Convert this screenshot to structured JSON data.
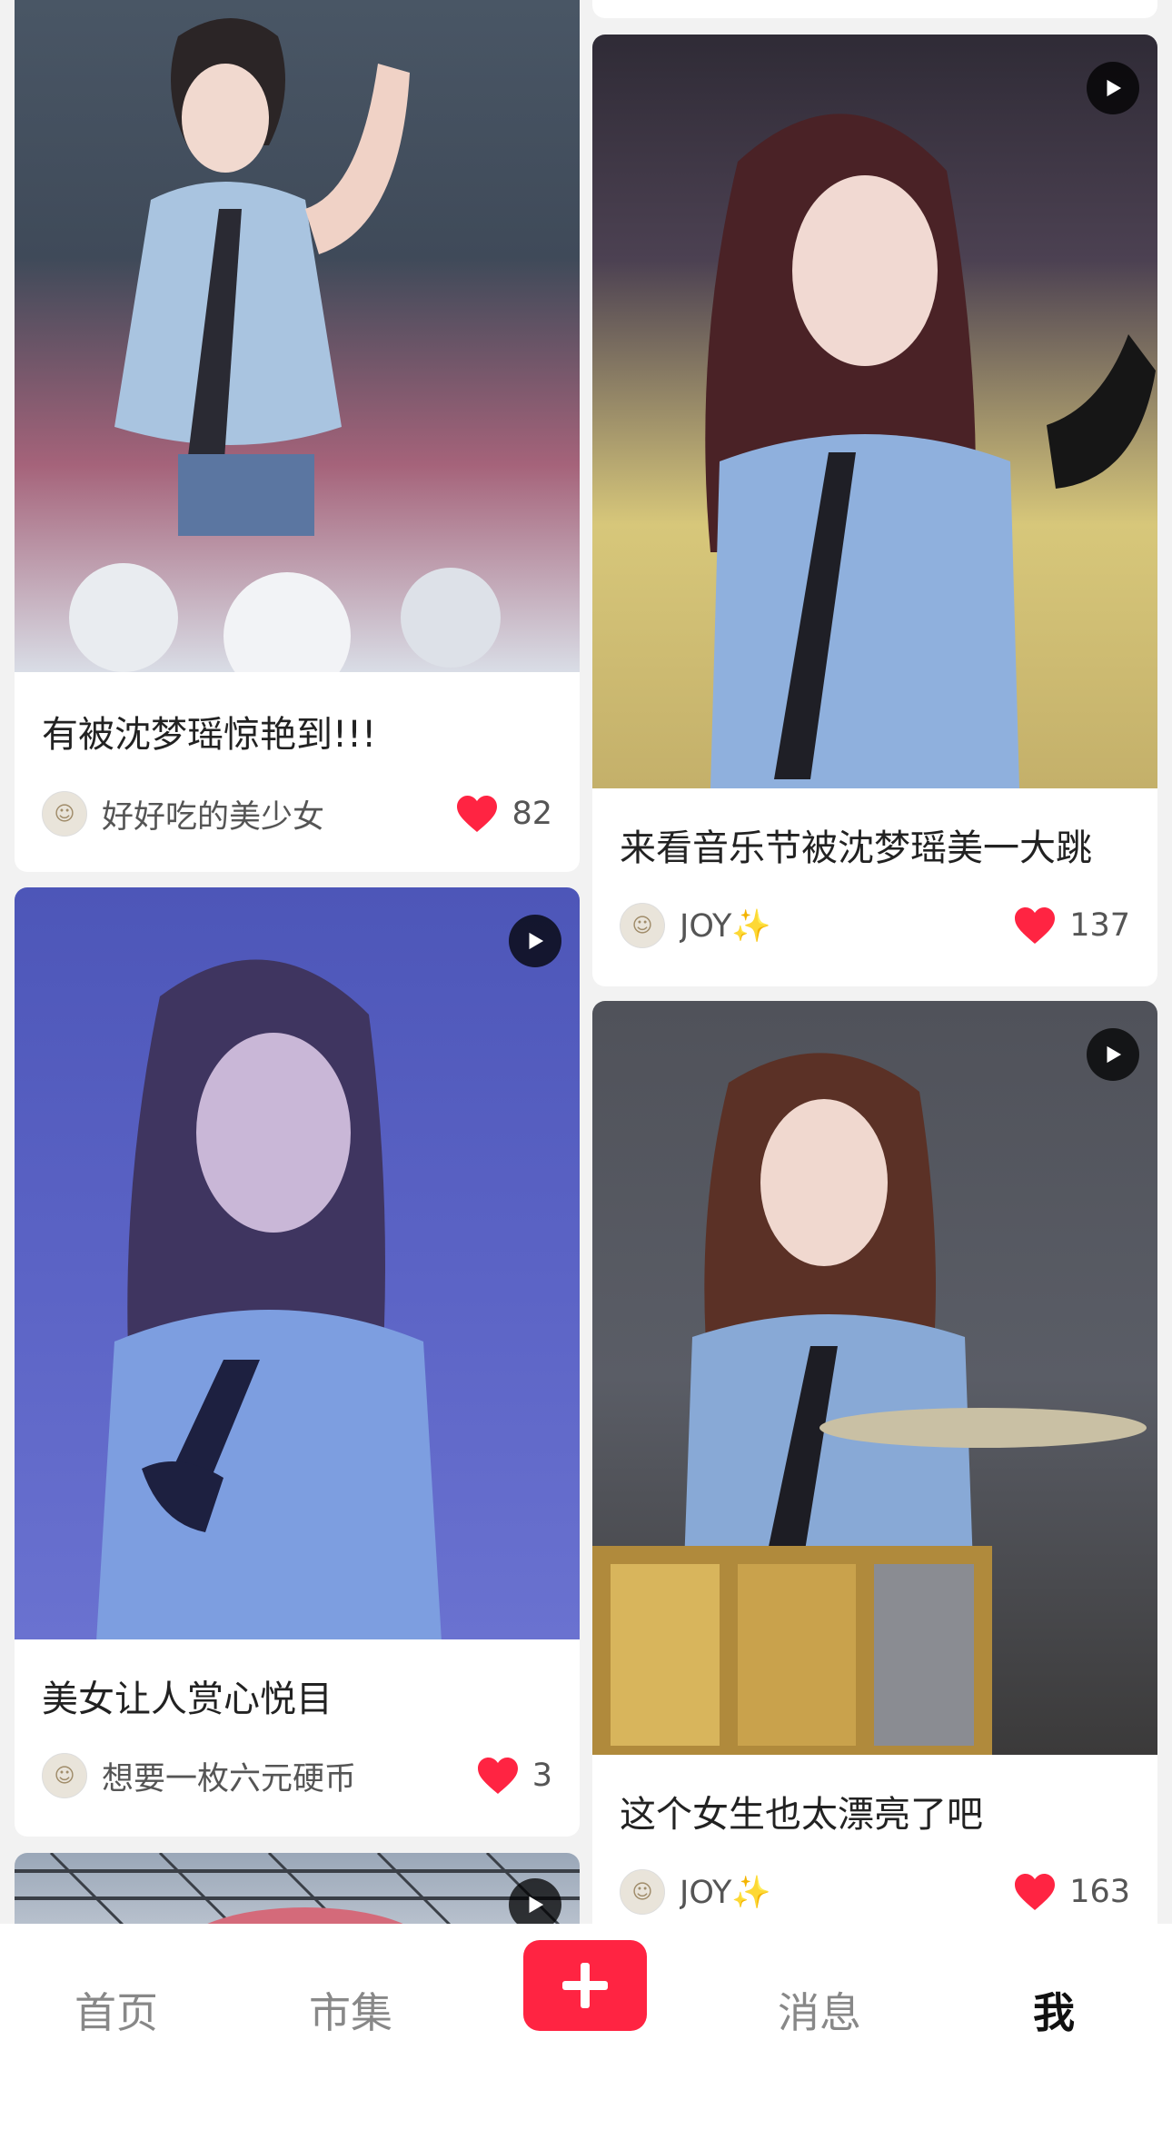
{
  "posts": [
    {
      "title": "有被沈梦瑶惊艳到!!!",
      "author": "好好吃的美少女",
      "likes": "82",
      "is_video": false
    },
    {
      "title": "来看音乐节被沈梦瑶美一大跳",
      "author": "JOY✨",
      "likes": "137",
      "is_video": true
    },
    {
      "title": "美女让人赏心悦目",
      "author": "想要一枚六元硬币",
      "likes": "3",
      "is_video": true
    },
    {
      "title": "这个女生也太漂亮了吧",
      "author": "JOY✨",
      "likes": "163",
      "is_video": true
    }
  ],
  "nav": {
    "home": "首页",
    "market": "市集",
    "add_icon": "plus-icon",
    "messages": "消息",
    "me": "我"
  },
  "colors": {
    "accent": "#ff2442",
    "heart": "#ff2442"
  }
}
